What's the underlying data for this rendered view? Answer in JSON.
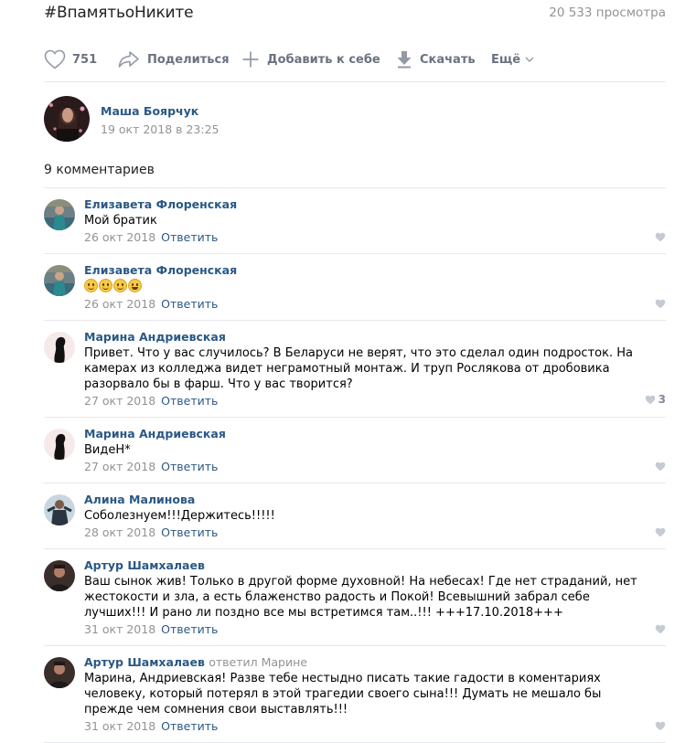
{
  "video": {
    "title": "#ВпамятьоНиките",
    "views": "20 533 просмотра"
  },
  "actions": {
    "like_count": "751",
    "share_label": "Поделиться",
    "add_label": "Добавить к себе",
    "download_label": "Скачать",
    "more_label": "Ещё"
  },
  "author": {
    "name": "Маша Боярчук",
    "date": "19 окт 2018 в 23:25"
  },
  "comments_count": "9 комментариев",
  "reply_label": "Ответить",
  "comments": [
    {
      "name": "Елизавета Флоренская",
      "text": "Мой братик",
      "date": "26 окт 2018",
      "likes": ""
    },
    {
      "name": "Елизавета Флоренская",
      "text": "",
      "emojis": [
        "smile",
        "smile",
        "smile",
        "laugh"
      ],
      "date": "26 окт 2018",
      "likes": ""
    },
    {
      "name": "Марина Андриевская",
      "text": "Привет. Что у вас случилось? В Беларуси не верят, что это сделал один подросток. На камерах из колледжа видет неграмотный монтаж. И труп Рослякова от дробовика разорвало бы в фарш. Что у вас творится?",
      "date": "27 окт 2018",
      "likes": "3"
    },
    {
      "name": "Марина Андриевская",
      "text": "ВидеН*",
      "date": "27 окт 2018",
      "likes": ""
    },
    {
      "name": "Алина Малинова",
      "text": "Соболезнуем!!!Держитесь!!!!!",
      "date": "28 окт 2018",
      "likes": ""
    },
    {
      "name": "Артур Шамхалаев",
      "text": "Ваш сынок жив! Только в другой форме духовной! На небесах! Где нет страданий, нет жестокости и зла, а есть блаженство радость и Покой! Всевышний забрал себе лучших!!! И рано ли поздно все мы встретимся там..!!! +++17.10.2018+++",
      "date": "31 окт 2018",
      "likes": ""
    },
    {
      "name": "Артур Шамхалаев",
      "reply_to": "ответил Марине",
      "text": "Марина, Андриевская! Разве тебе нестыдно писать такие гадости в коментариях человеку, который потерял в этой трагедии своего сына!!! Думать не мешало бы прежде чем сомнения свои выставлять!!!",
      "date": "31 окт 2018",
      "likes": ""
    }
  ],
  "colors": {
    "link": "#2a5885",
    "muted": "#939393",
    "icon": "#828a99",
    "divider": "#e7e8ec"
  },
  "icons": {
    "like": "heart-icon",
    "share": "share-arrow-icon",
    "add": "plus-icon",
    "download": "download-arrow-icon",
    "more": "chevron-down-icon"
  }
}
